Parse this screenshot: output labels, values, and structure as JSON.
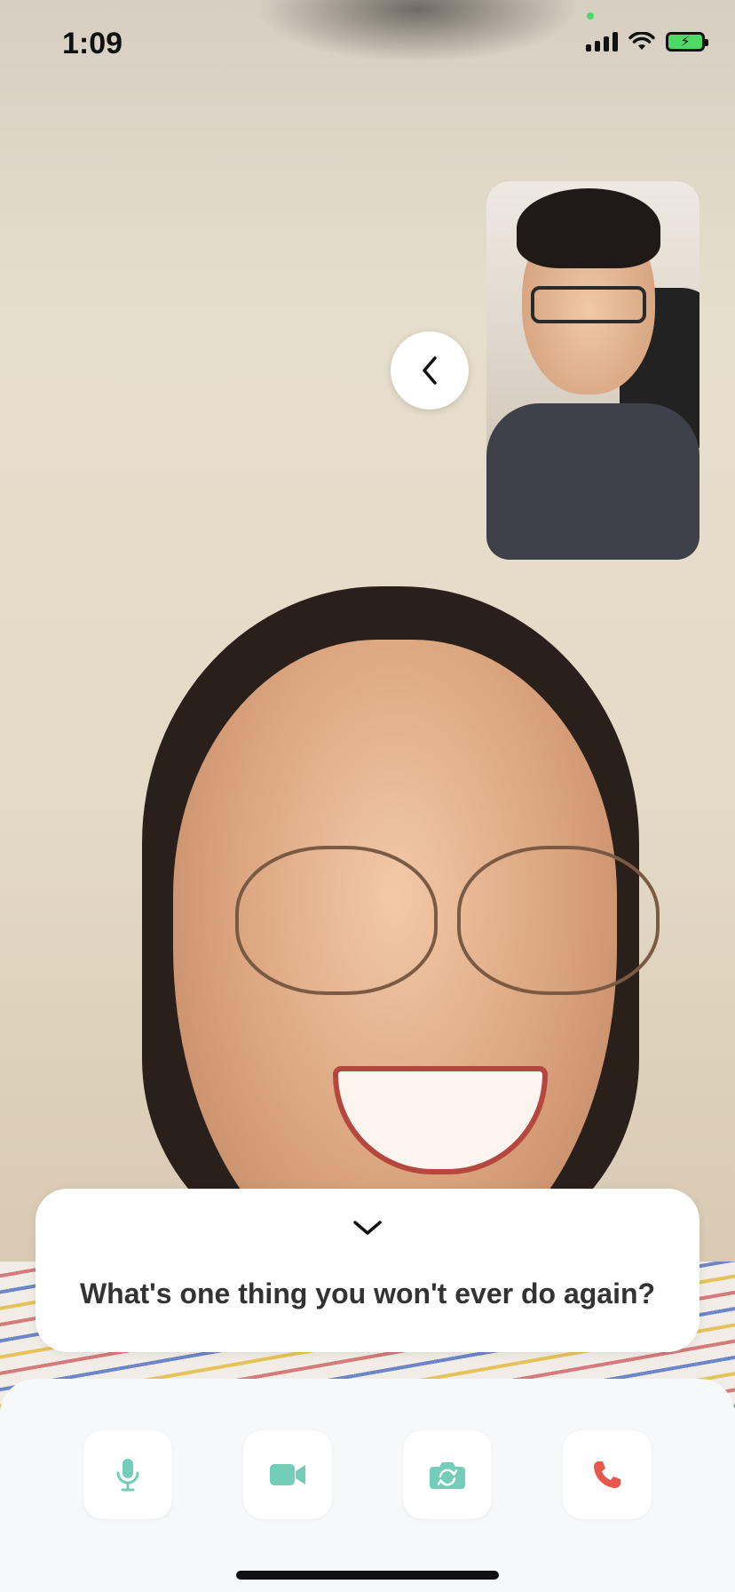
{
  "status_bar": {
    "time": "1:09"
  },
  "call": {
    "prompt_question": "What's one thing you won't ever do again?"
  },
  "controls": {
    "mic_icon": "microphone-icon",
    "video_icon": "video-camera-icon",
    "flip_icon": "flip-camera-icon",
    "end_icon": "phone-end-icon"
  },
  "colors": {
    "accent_teal": "#74CDB8",
    "end_call_red": "#E8574C",
    "panel_bg": "#F7F8FA",
    "card_bg": "#FFFFFF",
    "text_dark": "#333333"
  }
}
